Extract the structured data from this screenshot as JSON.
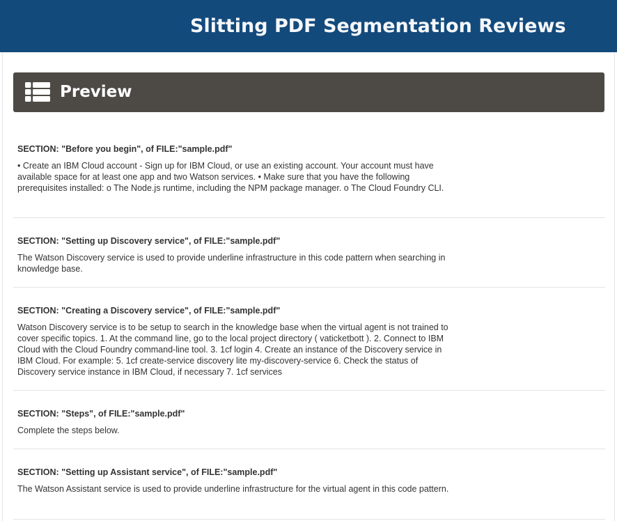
{
  "header": {
    "title": "Slitting PDF Segmentation Reviews"
  },
  "panel": {
    "icon": "list-icon",
    "title": "Preview"
  },
  "sections": [
    {
      "heading": "SECTION: \"Before you begin\", of FILE:\"sample.pdf\"",
      "body": "• Create an IBM Cloud account - Sign up for IBM Cloud, or use an existing account. Your account must have available space for at least one app and two Watson services. • Make sure that you have the following prerequisites installed: o The Node.js runtime, including the NPM package manager. o The Cloud Foundry CLI."
    },
    {
      "heading": "SECTION: \"Setting up Discovery service\", of FILE:\"sample.pdf\"",
      "body": "The Watson Discovery service is used to provide underline infrastructure in this code pattern when searching in knowledge base."
    },
    {
      "heading": "SECTION: \"Creating a Discovery service\", of FILE:\"sample.pdf\"",
      "body": "Watson Discovery service is to be setup to search in the knowledge base when the virtual agent is not trained to cover specific topics. 1. At the command line, go to the local project directory ( vaticketbott ). 2. Connect to IBM Cloud with the Cloud Foundry command-line tool. 3. 1cf login 4. Create an instance of the Discovery service in IBM Cloud. For example: 5. 1cf create-service discovery lite my-discovery-service 6. Check the status of Discovery service instance in IBM Cloud, if necessary 7. 1cf services"
    },
    {
      "heading": "SECTION: \"Steps\", of FILE:\"sample.pdf\"",
      "body": "Complete the steps below."
    },
    {
      "heading": "SECTION: \"Setting up Assistant service\", of FILE:\"sample.pdf\"",
      "body": "The Watson Assistant service is used to provide underline infrastructure for the virtual agent in this code pattern."
    }
  ]
}
